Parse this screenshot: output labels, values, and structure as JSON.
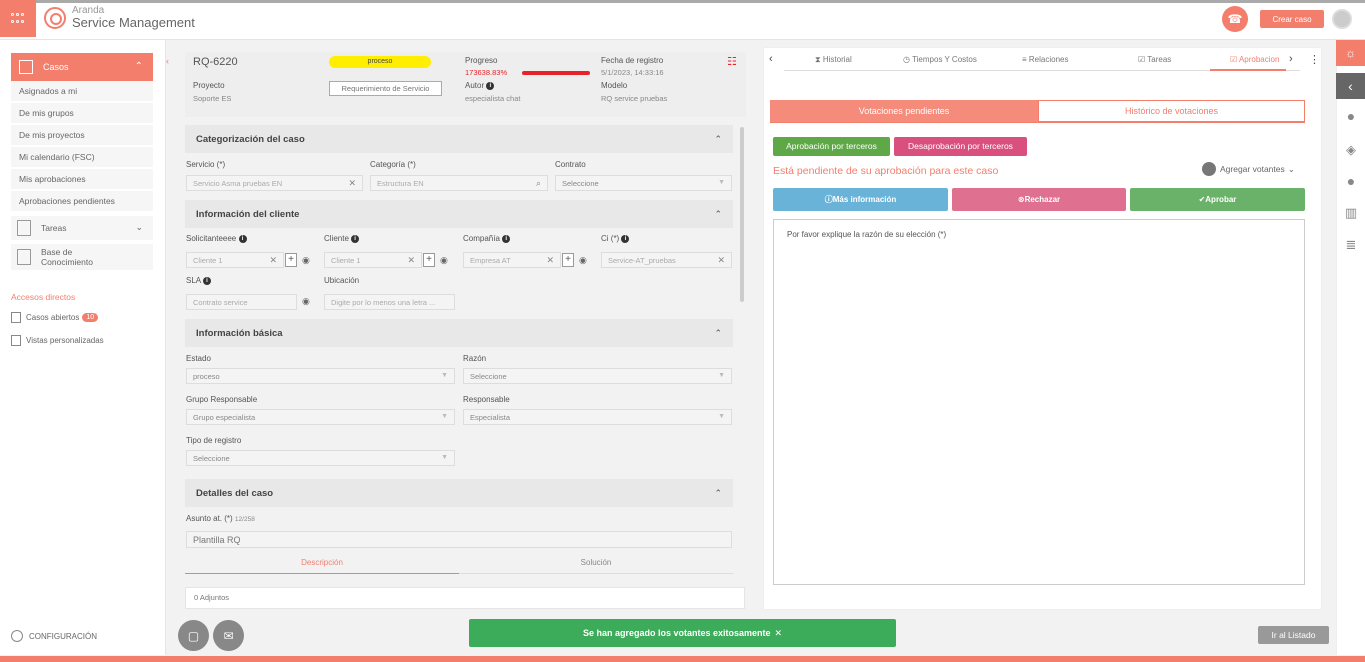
{
  "app": {
    "brand_line1": "Aranda",
    "brand_line2": "Service Management",
    "create_case_label": "Crear caso"
  },
  "sidebar": {
    "cases_label": "Casos",
    "sub_items": [
      "Asignados a mi",
      "De mis grupos",
      "De mis proyectos",
      "Mi calendario (FSC)",
      "Mis aprobaciones",
      "Aprobaciones pendientes"
    ],
    "tasks_label": "Tareas",
    "knowledge_line1": "Base de",
    "knowledge_line2": "Conocimiento",
    "shortcuts_title": "Accesos directos",
    "shortcut_open_cases": "Casos abiertos",
    "shortcut_open_cases_count": "10",
    "shortcut_custom_views": "Vistas personalizadas",
    "config_label": "CONFIGURACIÓN"
  },
  "case": {
    "id": "RQ-6220",
    "status": "proceso",
    "project_label": "Proyecto",
    "project_value": "Soporte ES",
    "service_request_label": "Requerimiento de Servicio",
    "progress_label": "Progreso",
    "progress_value": "173638.83%",
    "author_label": "Autor",
    "author_value": "especialista chat",
    "registered_label": "Fecha de registro",
    "registered_value": "5/1/2023, 14:33:16",
    "model_label": "Modelo",
    "model_value": "RQ service pruebas"
  },
  "sections": {
    "categorization": "Categorización del caso",
    "client_info": "Información del cliente",
    "basic_info": "Información básica",
    "details": "Detalles del caso"
  },
  "categorization": {
    "service_label": "Servicio (*)",
    "service_value": "Servicio Asma pruebas EN",
    "category_label": "Categoría (*)",
    "category_value": "Estructura EN",
    "contract_label": "Contrato",
    "contract_value": "Seleccione"
  },
  "client": {
    "requester_label": "Solicitanteeee",
    "requester_value": "Cliente 1",
    "client_label": "Cliente",
    "client_value": "Cliente 1",
    "company_label": "Compañía",
    "company_value": "Empresa AT",
    "ci_label": "Ci (*)",
    "ci_value": "Service-AT_pruebas",
    "sla_label": "SLA",
    "sla_value": "Contrato service",
    "location_label": "Ubicación",
    "location_placeholder": "Digite por lo menos una letra ..."
  },
  "basic": {
    "state_label": "Estado",
    "state_value": "proceso",
    "reason_label": "Razón",
    "reason_value": "Seleccione",
    "group_label": "Grupo Responsable",
    "group_value": "Grupo especialista",
    "responsible_label": "Responsable",
    "responsible_value": "Especialista",
    "register_type_label": "Tipo de registro",
    "register_type_value": "Seleccione"
  },
  "details": {
    "subject_label": "Asunto at. (*)",
    "subject_count": "12/258",
    "subject_value": "Plantilla RQ",
    "tab_description": "Descripción",
    "tab_solution": "Solución",
    "attachments": "0 Adjuntos"
  },
  "right_tabs": [
    "Historial",
    "Tiempos Y Costos",
    "Relaciones",
    "Tareas",
    "Aprobacion"
  ],
  "approvals": {
    "seg_pending": "Votaciones pendientes",
    "seg_history": "Histórico de votaciones",
    "approve_third": "Aprobación por terceros",
    "disapprove_third": "Desaprobación por terceros",
    "pending_message": "Está pendiente de su aprobación para este caso",
    "add_voters": "Agregar votantes",
    "more_info": "Más información",
    "reject": "Rechazar",
    "approve": "Aprobar",
    "reason_prompt": "Por favor explique la razón de su elección (*)",
    "more_info_color": "#69b3d9",
    "reject_color": "#df7090",
    "approve_color": "#6ab26a"
  },
  "toast": {
    "message": "Se han agregado los votantes exitosamente"
  },
  "footer": {
    "go_list": "Ir al Listado"
  },
  "colors": {
    "accent": "#f47e6c",
    "status_yellow": "#ffee00",
    "progress_red": "#e8232a",
    "success_green": "#3cac5a"
  }
}
